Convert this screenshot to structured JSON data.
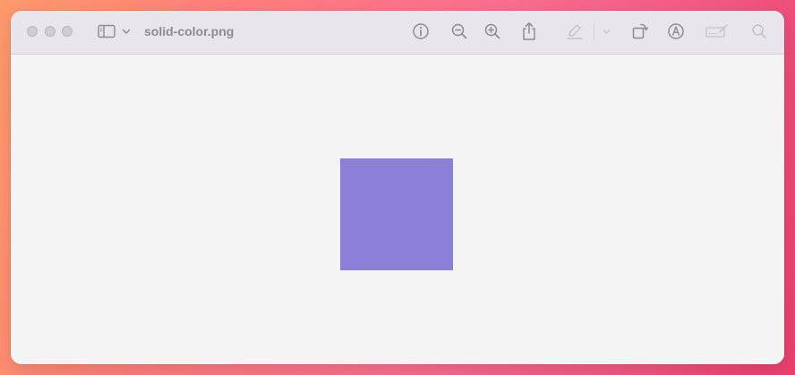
{
  "window": {
    "title": "solid-color.png"
  },
  "image": {
    "fill_color": "#8b7fd9"
  },
  "toolbar": {
    "icons": [
      "sidebar-icon",
      "chevron-down-icon",
      "info-icon",
      "zoom-out-icon",
      "zoom-in-icon",
      "share-icon",
      "highlight-pen-icon",
      "chevron-down-icon",
      "rotate-icon",
      "markup-icon",
      "signature-icon",
      "search-icon"
    ]
  },
  "colors": {
    "titlebar": "#e8e5ec",
    "content_background": "#f4f4f4",
    "icon": "#8d8b90",
    "icon_disabled": "#c4c2c7"
  }
}
